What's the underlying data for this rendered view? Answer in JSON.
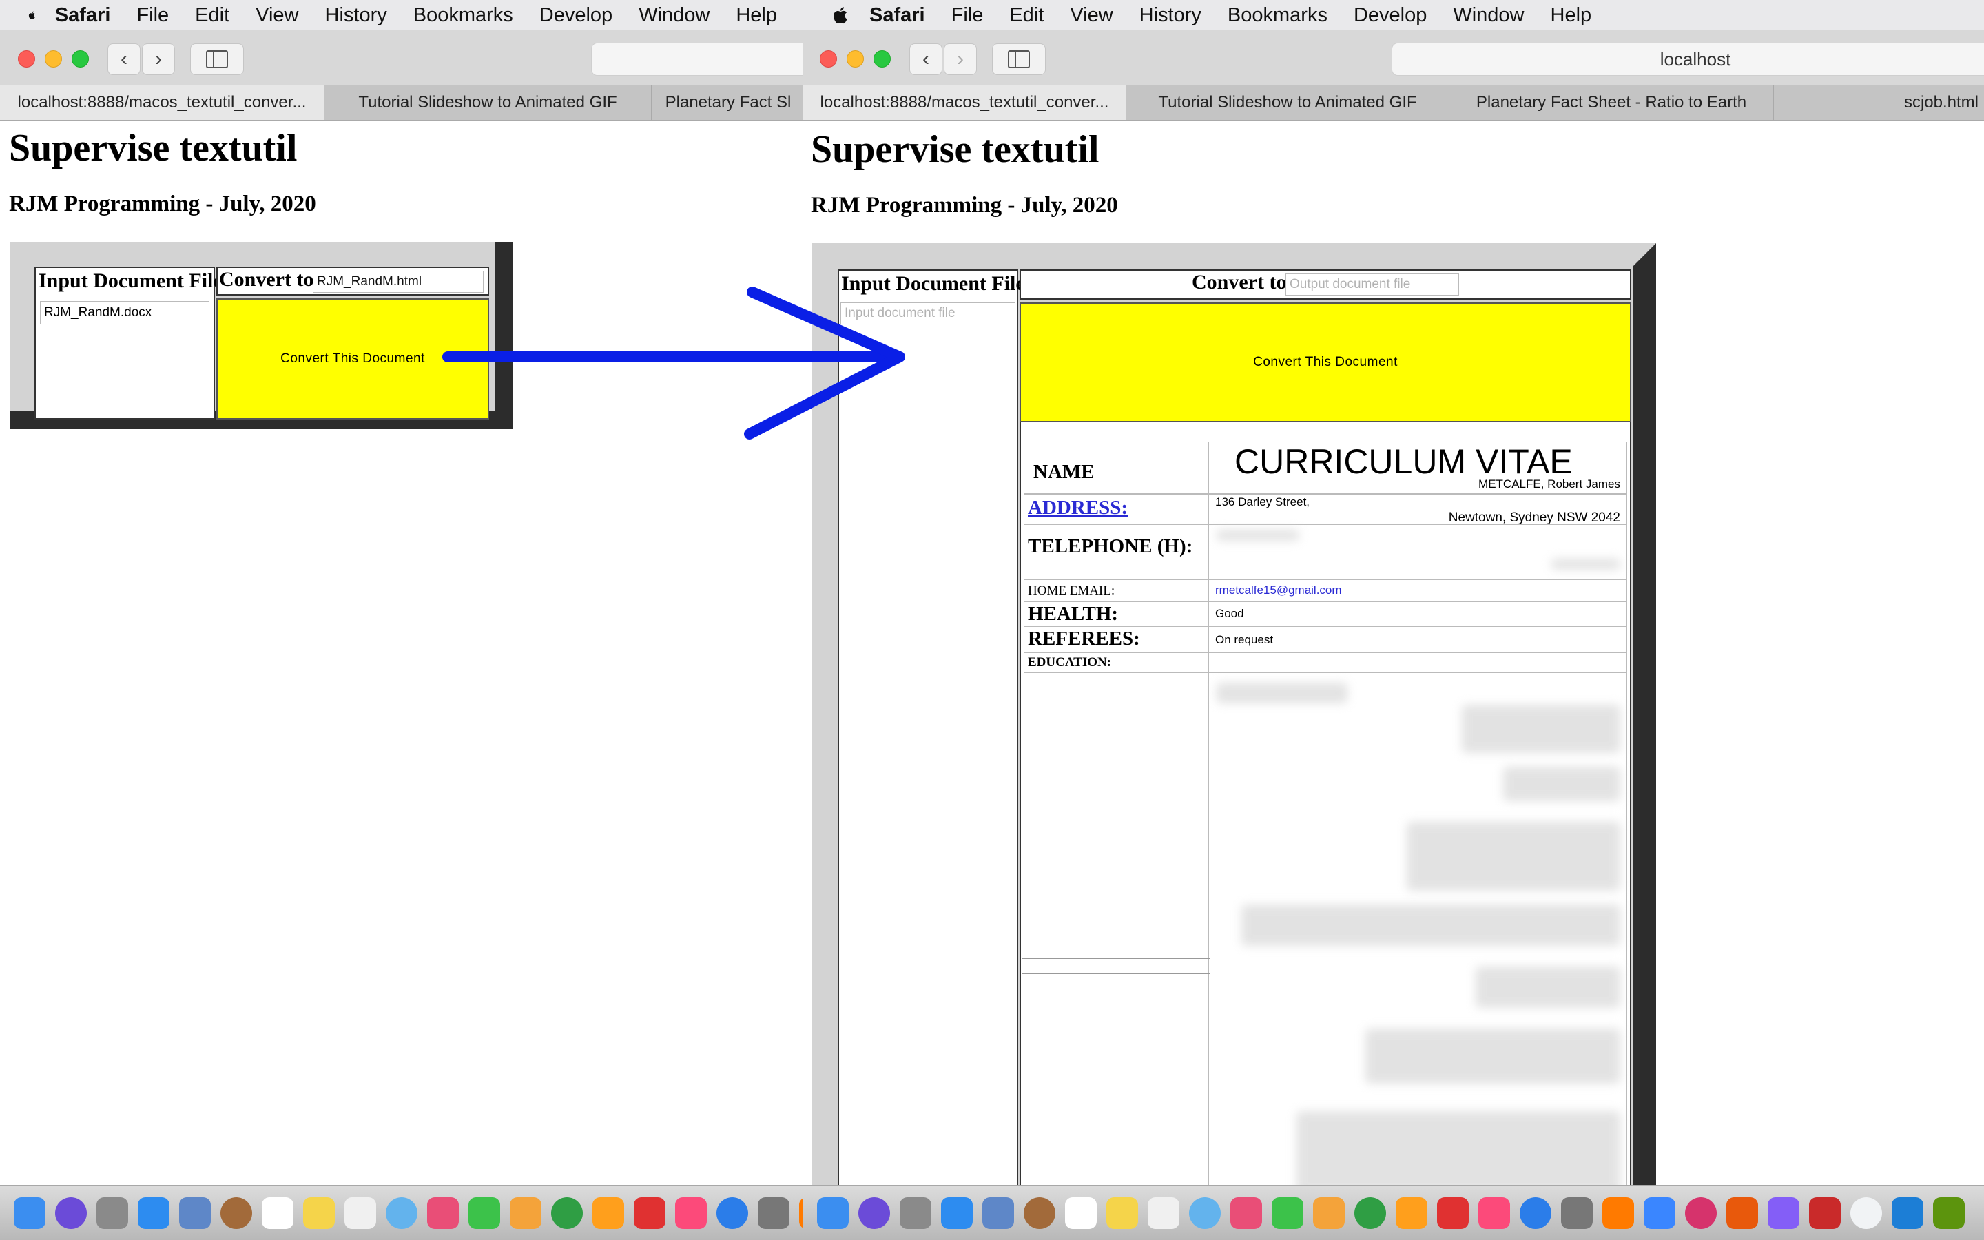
{
  "menubar": {
    "app": "Safari",
    "items": [
      "File",
      "Edit",
      "View",
      "History",
      "Bookmarks",
      "Develop",
      "Window",
      "Help"
    ]
  },
  "left": {
    "tabs": [
      "localhost:8888/macos_textutil_conver...",
      "Tutorial Slideshow to Animated GIF",
      "Planetary Fact Sl"
    ],
    "page": {
      "title": "Supervise textutil",
      "subtitle": "RJM Programming - July, 2020",
      "input_header": "Input Document File",
      "convert_label": "Convert to",
      "input_value": "RJM_RandM.docx",
      "output_value": "RJM_RandM.html",
      "button": "Convert This Document"
    }
  },
  "right": {
    "url": "localhost",
    "tabs": [
      "localhost:8888/macos_textutil_conver...",
      "Tutorial Slideshow to Animated GIF",
      "Planetary Fact Sheet - Ratio to Earth",
      "scjob.html"
    ],
    "page": {
      "title": "Supervise textutil",
      "subtitle": "RJM Programming - July, 2020",
      "input_header": "Input Document File",
      "convert_label": "Convert to",
      "input_placeholder": "Input document file",
      "output_placeholder": "Output document file",
      "button": "Convert This Document"
    },
    "cv": {
      "title": "CURRICULUM VITAE",
      "name_label": "NAME",
      "name_value": "METCALFE, Robert James",
      "address_label": "ADDRESS:",
      "address_line1": "136 Darley Street,",
      "address_line2": "Newtown, Sydney NSW 2042",
      "telephone_label": "TELEPHONE (H):",
      "email_label": "HOME EMAIL:",
      "email_value": "rmetcalfe15@gmail.com",
      "health_label": "HEALTH:",
      "health_value": "Good",
      "referees_label": "REFEREES:",
      "referees_value": "On request",
      "education_label": "EDUCATION:"
    }
  },
  "dock": {
    "left_count": 20,
    "right_count": 28,
    "colors": [
      "#3b8ef0",
      "#6b4bd8",
      "#8a8a8a",
      "#2d8cf0",
      "#5e87c8",
      "#a26a3a",
      "#ffffff",
      "#f5d44a",
      "#f0f0f0",
      "#63b3ed",
      "#e94e77",
      "#3cc24a",
      "#f4a33a",
      "#2f9e44",
      "#ff9f1c",
      "#e03131",
      "#fc4a7a",
      "#2b7de9",
      "#777777",
      "#ff7a00",
      "#3a86ff",
      "#d6336c",
      "#e8590c",
      "#845ef7",
      "#c92a2a",
      "#f1f3f5",
      "#1c7ed6",
      "#5c940d"
    ]
  },
  "annotation": {
    "arrow_color": "#0a1fe6"
  }
}
